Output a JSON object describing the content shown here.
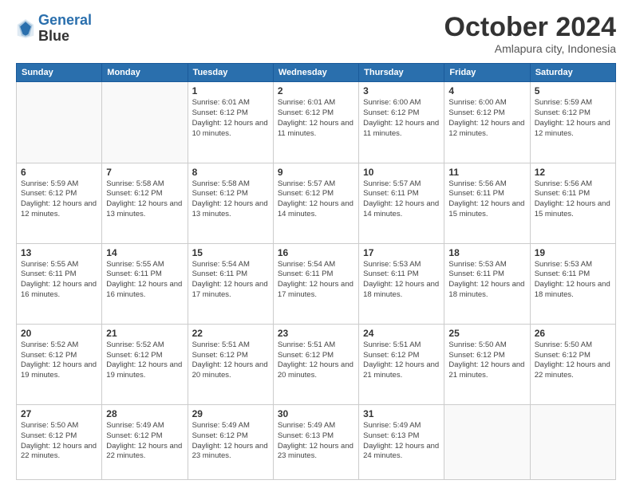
{
  "header": {
    "logo_line1": "General",
    "logo_line2": "Blue",
    "month_title": "October 2024",
    "subtitle": "Amlapura city, Indonesia"
  },
  "weekdays": [
    "Sunday",
    "Monday",
    "Tuesday",
    "Wednesday",
    "Thursday",
    "Friday",
    "Saturday"
  ],
  "weeks": [
    [
      {
        "day": "",
        "sunrise": "",
        "sunset": "",
        "daylight": ""
      },
      {
        "day": "",
        "sunrise": "",
        "sunset": "",
        "daylight": ""
      },
      {
        "day": "1",
        "sunrise": "Sunrise: 6:01 AM",
        "sunset": "Sunset: 6:12 PM",
        "daylight": "Daylight: 12 hours and 10 minutes."
      },
      {
        "day": "2",
        "sunrise": "Sunrise: 6:01 AM",
        "sunset": "Sunset: 6:12 PM",
        "daylight": "Daylight: 12 hours and 11 minutes."
      },
      {
        "day": "3",
        "sunrise": "Sunrise: 6:00 AM",
        "sunset": "Sunset: 6:12 PM",
        "daylight": "Daylight: 12 hours and 11 minutes."
      },
      {
        "day": "4",
        "sunrise": "Sunrise: 6:00 AM",
        "sunset": "Sunset: 6:12 PM",
        "daylight": "Daylight: 12 hours and 12 minutes."
      },
      {
        "day": "5",
        "sunrise": "Sunrise: 5:59 AM",
        "sunset": "Sunset: 6:12 PM",
        "daylight": "Daylight: 12 hours and 12 minutes."
      }
    ],
    [
      {
        "day": "6",
        "sunrise": "Sunrise: 5:59 AM",
        "sunset": "Sunset: 6:12 PM",
        "daylight": "Daylight: 12 hours and 12 minutes."
      },
      {
        "day": "7",
        "sunrise": "Sunrise: 5:58 AM",
        "sunset": "Sunset: 6:12 PM",
        "daylight": "Daylight: 12 hours and 13 minutes."
      },
      {
        "day": "8",
        "sunrise": "Sunrise: 5:58 AM",
        "sunset": "Sunset: 6:12 PM",
        "daylight": "Daylight: 12 hours and 13 minutes."
      },
      {
        "day": "9",
        "sunrise": "Sunrise: 5:57 AM",
        "sunset": "Sunset: 6:12 PM",
        "daylight": "Daylight: 12 hours and 14 minutes."
      },
      {
        "day": "10",
        "sunrise": "Sunrise: 5:57 AM",
        "sunset": "Sunset: 6:11 PM",
        "daylight": "Daylight: 12 hours and 14 minutes."
      },
      {
        "day": "11",
        "sunrise": "Sunrise: 5:56 AM",
        "sunset": "Sunset: 6:11 PM",
        "daylight": "Daylight: 12 hours and 15 minutes."
      },
      {
        "day": "12",
        "sunrise": "Sunrise: 5:56 AM",
        "sunset": "Sunset: 6:11 PM",
        "daylight": "Daylight: 12 hours and 15 minutes."
      }
    ],
    [
      {
        "day": "13",
        "sunrise": "Sunrise: 5:55 AM",
        "sunset": "Sunset: 6:11 PM",
        "daylight": "Daylight: 12 hours and 16 minutes."
      },
      {
        "day": "14",
        "sunrise": "Sunrise: 5:55 AM",
        "sunset": "Sunset: 6:11 PM",
        "daylight": "Daylight: 12 hours and 16 minutes."
      },
      {
        "day": "15",
        "sunrise": "Sunrise: 5:54 AM",
        "sunset": "Sunset: 6:11 PM",
        "daylight": "Daylight: 12 hours and 17 minutes."
      },
      {
        "day": "16",
        "sunrise": "Sunrise: 5:54 AM",
        "sunset": "Sunset: 6:11 PM",
        "daylight": "Daylight: 12 hours and 17 minutes."
      },
      {
        "day": "17",
        "sunrise": "Sunrise: 5:53 AM",
        "sunset": "Sunset: 6:11 PM",
        "daylight": "Daylight: 12 hours and 18 minutes."
      },
      {
        "day": "18",
        "sunrise": "Sunrise: 5:53 AM",
        "sunset": "Sunset: 6:11 PM",
        "daylight": "Daylight: 12 hours and 18 minutes."
      },
      {
        "day": "19",
        "sunrise": "Sunrise: 5:53 AM",
        "sunset": "Sunset: 6:11 PM",
        "daylight": "Daylight: 12 hours and 18 minutes."
      }
    ],
    [
      {
        "day": "20",
        "sunrise": "Sunrise: 5:52 AM",
        "sunset": "Sunset: 6:12 PM",
        "daylight": "Daylight: 12 hours and 19 minutes."
      },
      {
        "day": "21",
        "sunrise": "Sunrise: 5:52 AM",
        "sunset": "Sunset: 6:12 PM",
        "daylight": "Daylight: 12 hours and 19 minutes."
      },
      {
        "day": "22",
        "sunrise": "Sunrise: 5:51 AM",
        "sunset": "Sunset: 6:12 PM",
        "daylight": "Daylight: 12 hours and 20 minutes."
      },
      {
        "day": "23",
        "sunrise": "Sunrise: 5:51 AM",
        "sunset": "Sunset: 6:12 PM",
        "daylight": "Daylight: 12 hours and 20 minutes."
      },
      {
        "day": "24",
        "sunrise": "Sunrise: 5:51 AM",
        "sunset": "Sunset: 6:12 PM",
        "daylight": "Daylight: 12 hours and 21 minutes."
      },
      {
        "day": "25",
        "sunrise": "Sunrise: 5:50 AM",
        "sunset": "Sunset: 6:12 PM",
        "daylight": "Daylight: 12 hours and 21 minutes."
      },
      {
        "day": "26",
        "sunrise": "Sunrise: 5:50 AM",
        "sunset": "Sunset: 6:12 PM",
        "daylight": "Daylight: 12 hours and 22 minutes."
      }
    ],
    [
      {
        "day": "27",
        "sunrise": "Sunrise: 5:50 AM",
        "sunset": "Sunset: 6:12 PM",
        "daylight": "Daylight: 12 hours and 22 minutes."
      },
      {
        "day": "28",
        "sunrise": "Sunrise: 5:49 AM",
        "sunset": "Sunset: 6:12 PM",
        "daylight": "Daylight: 12 hours and 22 minutes."
      },
      {
        "day": "29",
        "sunrise": "Sunrise: 5:49 AM",
        "sunset": "Sunset: 6:12 PM",
        "daylight": "Daylight: 12 hours and 23 minutes."
      },
      {
        "day": "30",
        "sunrise": "Sunrise: 5:49 AM",
        "sunset": "Sunset: 6:13 PM",
        "daylight": "Daylight: 12 hours and 23 minutes."
      },
      {
        "day": "31",
        "sunrise": "Sunrise: 5:49 AM",
        "sunset": "Sunset: 6:13 PM",
        "daylight": "Daylight: 12 hours and 24 minutes."
      },
      {
        "day": "",
        "sunrise": "",
        "sunset": "",
        "daylight": ""
      },
      {
        "day": "",
        "sunrise": "",
        "sunset": "",
        "daylight": ""
      }
    ]
  ]
}
